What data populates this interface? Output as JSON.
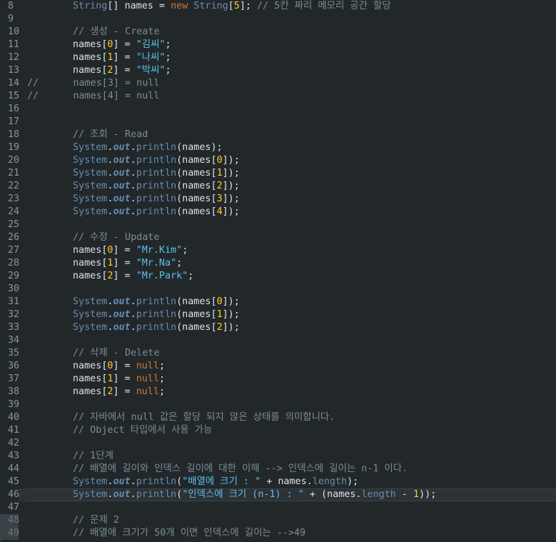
{
  "editor": {
    "lines": [
      {
        "n": "8",
        "tokens": [
          [
            "indent",
            ""
          ],
          [
            "t-type",
            "String"
          ],
          [
            "t-plain",
            "[] "
          ],
          [
            "t-var",
            "names"
          ],
          [
            "t-plain",
            " = "
          ],
          [
            "t-kw",
            "new"
          ],
          [
            "t-plain",
            " "
          ],
          [
            "t-type",
            "String"
          ],
          [
            "t-plain",
            "["
          ],
          [
            "t-num",
            "5"
          ],
          [
            "t-plain",
            "]; "
          ],
          [
            "t-cmt",
            "// 5칸 짜리 메모리 공간 할당"
          ]
        ]
      },
      {
        "n": "9",
        "tokens": []
      },
      {
        "n": "10",
        "tokens": [
          [
            "indent",
            ""
          ],
          [
            "t-cmt",
            "// 생성 - Create"
          ]
        ]
      },
      {
        "n": "11",
        "tokens": [
          [
            "indent",
            ""
          ],
          [
            "t-var",
            "names"
          ],
          [
            "t-plain",
            "["
          ],
          [
            "t-num",
            "0"
          ],
          [
            "t-plain",
            "] = "
          ],
          [
            "t-str-b",
            "\"김씨\""
          ],
          [
            "t-plain",
            ";"
          ]
        ]
      },
      {
        "n": "12",
        "tokens": [
          [
            "indent",
            ""
          ],
          [
            "t-var",
            "names"
          ],
          [
            "t-plain",
            "["
          ],
          [
            "t-num",
            "1"
          ],
          [
            "t-plain",
            "] = "
          ],
          [
            "t-str-b",
            "\"나씨\""
          ],
          [
            "t-plain",
            ";"
          ]
        ]
      },
      {
        "n": "13",
        "tokens": [
          [
            "indent",
            ""
          ],
          [
            "t-var",
            "names"
          ],
          [
            "t-plain",
            "["
          ],
          [
            "t-num",
            "2"
          ],
          [
            "t-plain",
            "] = "
          ],
          [
            "t-str-b",
            "\"박씨\""
          ],
          [
            "t-plain",
            ";"
          ]
        ]
      },
      {
        "n": "14",
        "tokens": [
          [
            "t-cmt",
            "//      names[3] = null"
          ]
        ]
      },
      {
        "n": "15",
        "tokens": [
          [
            "t-cmt",
            "//      names[4] = null"
          ]
        ]
      },
      {
        "n": "16",
        "tokens": []
      },
      {
        "n": "17",
        "tokens": []
      },
      {
        "n": "18",
        "tokens": [
          [
            "indent",
            ""
          ],
          [
            "t-cmt",
            "// 조회 - Read"
          ]
        ]
      },
      {
        "n": "19",
        "tokens": [
          [
            "indent",
            ""
          ],
          [
            "t-cls",
            "System"
          ],
          [
            "t-plain",
            "."
          ],
          [
            "t-field",
            "out"
          ],
          [
            "t-plain",
            "."
          ],
          [
            "t-meth",
            "println"
          ],
          [
            "t-plain",
            "(names);"
          ]
        ]
      },
      {
        "n": "20",
        "tokens": [
          [
            "indent",
            ""
          ],
          [
            "t-cls",
            "System"
          ],
          [
            "t-plain",
            "."
          ],
          [
            "t-field",
            "out"
          ],
          [
            "t-plain",
            "."
          ],
          [
            "t-meth",
            "println"
          ],
          [
            "t-plain",
            "(names["
          ],
          [
            "t-num",
            "0"
          ],
          [
            "t-plain",
            "]);"
          ]
        ]
      },
      {
        "n": "21",
        "tokens": [
          [
            "indent",
            ""
          ],
          [
            "t-cls",
            "System"
          ],
          [
            "t-plain",
            "."
          ],
          [
            "t-field",
            "out"
          ],
          [
            "t-plain",
            "."
          ],
          [
            "t-meth",
            "println"
          ],
          [
            "t-plain",
            "(names["
          ],
          [
            "t-num",
            "1"
          ],
          [
            "t-plain",
            "]);"
          ]
        ]
      },
      {
        "n": "22",
        "tokens": [
          [
            "indent",
            ""
          ],
          [
            "t-cls",
            "System"
          ],
          [
            "t-plain",
            "."
          ],
          [
            "t-field",
            "out"
          ],
          [
            "t-plain",
            "."
          ],
          [
            "t-meth",
            "println"
          ],
          [
            "t-plain",
            "(names["
          ],
          [
            "t-num",
            "2"
          ],
          [
            "t-plain",
            "]);"
          ]
        ]
      },
      {
        "n": "23",
        "tokens": [
          [
            "indent",
            ""
          ],
          [
            "t-cls",
            "System"
          ],
          [
            "t-plain",
            "."
          ],
          [
            "t-field",
            "out"
          ],
          [
            "t-plain",
            "."
          ],
          [
            "t-meth",
            "println"
          ],
          [
            "t-plain",
            "(names["
          ],
          [
            "t-num",
            "3"
          ],
          [
            "t-plain",
            "]);"
          ]
        ]
      },
      {
        "n": "24",
        "tokens": [
          [
            "indent",
            ""
          ],
          [
            "t-cls",
            "System"
          ],
          [
            "t-plain",
            "."
          ],
          [
            "t-field",
            "out"
          ],
          [
            "t-plain",
            "."
          ],
          [
            "t-meth",
            "println"
          ],
          [
            "t-plain",
            "(names["
          ],
          [
            "t-num",
            "4"
          ],
          [
            "t-plain",
            "]);"
          ]
        ]
      },
      {
        "n": "25",
        "tokens": []
      },
      {
        "n": "26",
        "tokens": [
          [
            "indent",
            ""
          ],
          [
            "t-cmt",
            "// 수정 - Update"
          ]
        ]
      },
      {
        "n": "27",
        "tokens": [
          [
            "indent",
            ""
          ],
          [
            "t-var",
            "names"
          ],
          [
            "t-plain",
            "["
          ],
          [
            "t-num",
            "0"
          ],
          [
            "t-plain",
            "] = "
          ],
          [
            "t-str-b",
            "\"Mr.Kim\""
          ],
          [
            "t-plain",
            ";"
          ]
        ]
      },
      {
        "n": "28",
        "tokens": [
          [
            "indent",
            ""
          ],
          [
            "t-var",
            "names"
          ],
          [
            "t-plain",
            "["
          ],
          [
            "t-num",
            "1"
          ],
          [
            "t-plain",
            "] = "
          ],
          [
            "t-str-b",
            "\"Mr.Na\""
          ],
          [
            "t-plain",
            ";"
          ]
        ]
      },
      {
        "n": "29",
        "tokens": [
          [
            "indent",
            ""
          ],
          [
            "t-var",
            "names"
          ],
          [
            "t-plain",
            "["
          ],
          [
            "t-num",
            "2"
          ],
          [
            "t-plain",
            "] = "
          ],
          [
            "t-str-b",
            "\"Mr.Park\""
          ],
          [
            "t-plain",
            ";"
          ]
        ]
      },
      {
        "n": "30",
        "tokens": []
      },
      {
        "n": "31",
        "tokens": [
          [
            "indent",
            ""
          ],
          [
            "t-cls",
            "System"
          ],
          [
            "t-plain",
            "."
          ],
          [
            "t-field",
            "out"
          ],
          [
            "t-plain",
            "."
          ],
          [
            "t-meth",
            "println"
          ],
          [
            "t-plain",
            "(names["
          ],
          [
            "t-num",
            "0"
          ],
          [
            "t-plain",
            "]);"
          ]
        ]
      },
      {
        "n": "32",
        "tokens": [
          [
            "indent",
            ""
          ],
          [
            "t-cls",
            "System"
          ],
          [
            "t-plain",
            "."
          ],
          [
            "t-field",
            "out"
          ],
          [
            "t-plain",
            "."
          ],
          [
            "t-meth",
            "println"
          ],
          [
            "t-plain",
            "(names["
          ],
          [
            "t-num",
            "1"
          ],
          [
            "t-plain",
            "]);"
          ]
        ]
      },
      {
        "n": "33",
        "tokens": [
          [
            "indent",
            ""
          ],
          [
            "t-cls",
            "System"
          ],
          [
            "t-plain",
            "."
          ],
          [
            "t-field",
            "out"
          ],
          [
            "t-plain",
            "."
          ],
          [
            "t-meth",
            "println"
          ],
          [
            "t-plain",
            "(names["
          ],
          [
            "t-num",
            "2"
          ],
          [
            "t-plain",
            "]);"
          ]
        ]
      },
      {
        "n": "34",
        "tokens": []
      },
      {
        "n": "35",
        "tokens": [
          [
            "indent",
            ""
          ],
          [
            "t-cmt",
            "// 삭제 - Delete"
          ]
        ]
      },
      {
        "n": "36",
        "tokens": [
          [
            "indent",
            ""
          ],
          [
            "t-var",
            "names"
          ],
          [
            "t-plain",
            "["
          ],
          [
            "t-num",
            "0"
          ],
          [
            "t-plain",
            "] = "
          ],
          [
            "t-kw",
            "null"
          ],
          [
            "t-plain",
            ";"
          ]
        ]
      },
      {
        "n": "37",
        "tokens": [
          [
            "indent",
            ""
          ],
          [
            "t-var",
            "names"
          ],
          [
            "t-plain",
            "["
          ],
          [
            "t-num",
            "1"
          ],
          [
            "t-plain",
            "] = "
          ],
          [
            "t-kw",
            "null"
          ],
          [
            "t-plain",
            ";"
          ]
        ]
      },
      {
        "n": "38",
        "tokens": [
          [
            "indent",
            ""
          ],
          [
            "t-var",
            "names"
          ],
          [
            "t-plain",
            "["
          ],
          [
            "t-num",
            "2"
          ],
          [
            "t-plain",
            "] = "
          ],
          [
            "t-kw",
            "null"
          ],
          [
            "t-plain",
            ";"
          ]
        ]
      },
      {
        "n": "39",
        "tokens": []
      },
      {
        "n": "40",
        "tokens": [
          [
            "indent",
            ""
          ],
          [
            "t-cmt",
            "// 자바에서 null 값은 할당 되지 않은 상태를 의미합니다."
          ]
        ]
      },
      {
        "n": "41",
        "tokens": [
          [
            "indent",
            ""
          ],
          [
            "t-cmt",
            "// Object 타입에서 사용 가능"
          ]
        ]
      },
      {
        "n": "42",
        "tokens": []
      },
      {
        "n": "43",
        "tokens": [
          [
            "indent",
            ""
          ],
          [
            "t-cmt",
            "// 1단계"
          ]
        ]
      },
      {
        "n": "44",
        "tokens": [
          [
            "indent",
            ""
          ],
          [
            "t-cmt",
            "// 배열에 길이와 인덱스 길이에 대한 이해 --> 인덱스에 길이는 n-1 이다."
          ]
        ]
      },
      {
        "n": "45",
        "tokens": [
          [
            "indent",
            ""
          ],
          [
            "t-cls",
            "System"
          ],
          [
            "t-plain",
            "."
          ],
          [
            "t-field",
            "out"
          ],
          [
            "t-plain",
            "."
          ],
          [
            "t-meth",
            "println"
          ],
          [
            "t-plain",
            "("
          ],
          [
            "t-str-b",
            "\"배열에 크기 : \""
          ],
          [
            "t-plain",
            " + names."
          ],
          [
            "t-fieldb",
            "length"
          ],
          [
            "t-plain",
            ");"
          ]
        ]
      },
      {
        "n": "46",
        "current": true,
        "tokens": [
          [
            "indent",
            ""
          ],
          [
            "t-cls",
            "System"
          ],
          [
            "t-plain",
            "."
          ],
          [
            "t-field",
            "out"
          ],
          [
            "t-plain",
            "."
          ],
          [
            "t-meth",
            "println"
          ],
          [
            "t-plain",
            "("
          ],
          [
            "t-str-b",
            "\"인덱스에 크기 (n-1) : \""
          ],
          [
            "t-plain",
            " + (names."
          ],
          [
            "t-fieldb",
            "length"
          ],
          [
            "t-plain",
            " - "
          ],
          [
            "t-num",
            "1"
          ],
          [
            "t-plain",
            "));"
          ]
        ]
      },
      {
        "n": "47",
        "tokens": []
      },
      {
        "n": "48",
        "mark": true,
        "tokens": [
          [
            "indent",
            ""
          ],
          [
            "t-cmt",
            "// 문제 2"
          ]
        ]
      },
      {
        "n": "49",
        "mark": true,
        "tokens": [
          [
            "indent",
            ""
          ],
          [
            "t-cmt",
            "// 배열에 크기가 50개 이면 인덱스에 길이는 -->49"
          ]
        ]
      }
    ]
  }
}
